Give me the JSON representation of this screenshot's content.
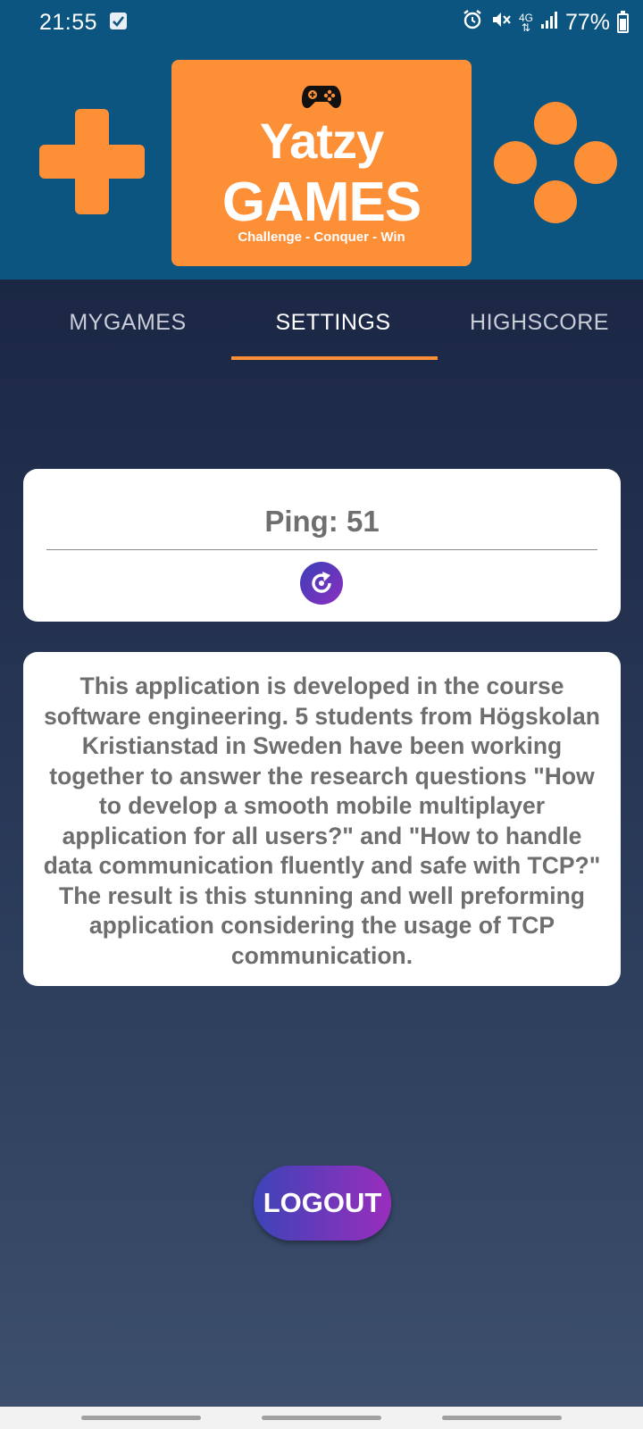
{
  "status_bar": {
    "time": "21:55",
    "network": "4G",
    "battery": "77%",
    "icons": [
      "checkbox-notification-icon",
      "alarm-icon",
      "mute-icon",
      "network-icon",
      "signal-icon",
      "battery-icon"
    ]
  },
  "header": {
    "logo_line1": "Yatzy",
    "logo_line2": "GAMES",
    "logo_tagline": "Challenge - Conquer - Win",
    "icons": [
      "gamepad-icon",
      "dpad-icon",
      "action-buttons-icon"
    ],
    "colors": {
      "banner": "#0b5580",
      "accent": "#fd8f36"
    }
  },
  "tabs": [
    {
      "label": "MYGAMES",
      "active": false
    },
    {
      "label": "SETTINGS",
      "active": true
    },
    {
      "label": "HIGHSCORE",
      "active": false
    }
  ],
  "ping": {
    "text": "Ping: 51",
    "refresh_icon": "refresh-icon"
  },
  "about": {
    "text": "This application is developed in the course software engineering. 5 students from Högskolan Kristianstad in Sweden have been working together to answer the research questions \"How to develop a smooth mobile multiplayer application for all users?\" and \"How to handle data communication fluently and safe with TCP?\" The result is this stunning and well preforming application considering the usage of TCP communication."
  },
  "logout": {
    "label": "LOGOUT"
  },
  "theme": {
    "background": "#1c2946",
    "button_gradient": [
      "#3c44b7",
      "#9a2dbd"
    ]
  }
}
